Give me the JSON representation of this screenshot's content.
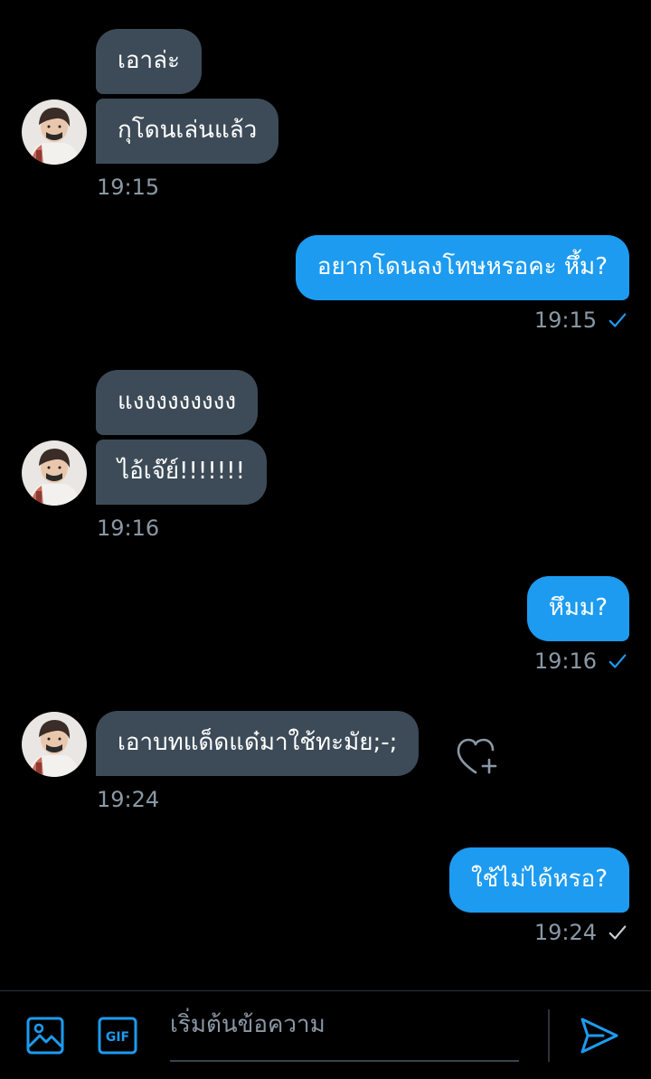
{
  "colors": {
    "background": "#000000",
    "incoming_bubble": "#3d4b58",
    "outgoing_bubble": "#1d9bf0",
    "timestamp": "#8b98a5",
    "accent": "#1d9bf0"
  },
  "messages": {
    "group1": {
      "bubble1": "เอาล่ะ",
      "bubble2": "กุโดนเล่นแล้ว",
      "time": "19:15"
    },
    "out1": {
      "text": "อยากโดนลงโทษหรอคะ หึ้ม?",
      "time": "19:15",
      "status": "read"
    },
    "group2": {
      "bubble1": "แงงงงงงงงง",
      "bubble2": "ไอ้เจ๊ย์!!!!!!!",
      "time": "19:16"
    },
    "out2": {
      "text": "หึมม?",
      "time": "19:16",
      "status": "read"
    },
    "group3": {
      "bubble1": "เอาบทแด็ดแด๋มาใช้ทะมัย;-;",
      "time": "19:24"
    },
    "out3": {
      "text": "ใช้ไม่ได้หรอ?",
      "time": "19:24",
      "status": "sent"
    }
  },
  "icons": {
    "reaction": "heart-plus-icon",
    "read_receipt": "check-icon",
    "media": "image-icon",
    "gif": "gif-icon",
    "send": "send-icon"
  },
  "composer": {
    "placeholder": "เริ่มต้นข้อความ",
    "gif_label": "GIF"
  }
}
